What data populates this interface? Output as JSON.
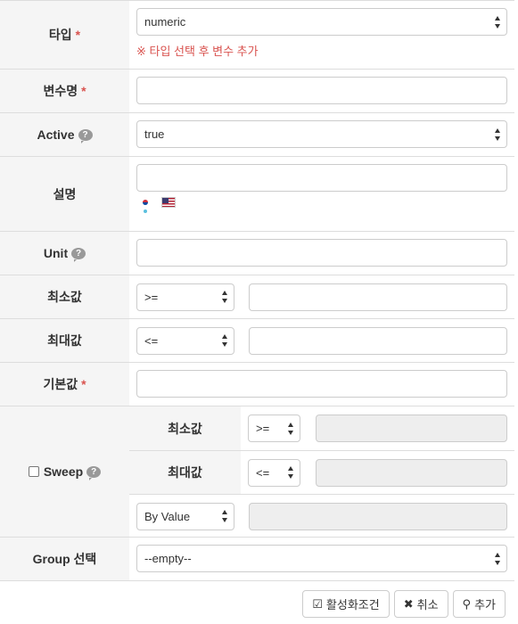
{
  "rows": {
    "type": {
      "label": "타입",
      "value": "numeric",
      "hint": "※ 타입 선택 후 변수 추가"
    },
    "var_name": {
      "label": "변수명",
      "value": ""
    },
    "active": {
      "label": "Active",
      "value": "true"
    },
    "description": {
      "label": "설명",
      "value": ""
    },
    "unit": {
      "label": "Unit",
      "value": ""
    },
    "min": {
      "label": "최소값",
      "op": ">=",
      "value": ""
    },
    "max": {
      "label": "최대값",
      "op": "<=",
      "value": ""
    },
    "default": {
      "label": "기본값",
      "value": ""
    },
    "sweep": {
      "label": "Sweep",
      "checked": false,
      "min": {
        "label": "최소값",
        "op": ">=",
        "value": ""
      },
      "max": {
        "label": "최대값",
        "op": "<=",
        "value": ""
      },
      "mode": "By Value",
      "mode_value": ""
    },
    "group": {
      "label": "Group 선택",
      "value": "--empty--"
    }
  },
  "required_mark": "*",
  "help_glyph": "?",
  "buttons": {
    "activate": {
      "label": "활성화조건",
      "icon": "check-square-icon"
    },
    "cancel": {
      "label": "취소",
      "icon": "close-icon"
    },
    "add": {
      "label": "추가",
      "icon": "search-icon"
    }
  },
  "colors": {
    "required": "#d9534f",
    "label_bg": "#f5f5f5",
    "border": "#dddddd"
  }
}
